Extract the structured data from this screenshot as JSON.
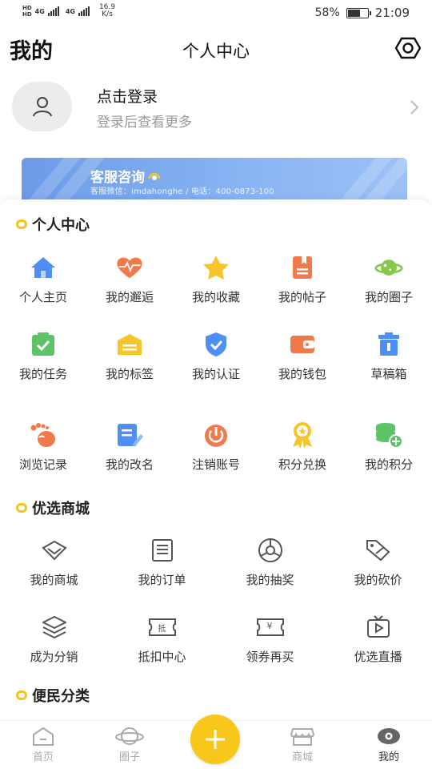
{
  "status_bar": {
    "hd1": "HD",
    "net1": "4G",
    "hd2": "HD",
    "net2": "4G",
    "speed_value": "16.9",
    "speed_unit": "K/s",
    "battery_percent": "58%",
    "battery_level": 0.58,
    "time": "21:09"
  },
  "header": {
    "left_title": "我的",
    "center_title": "个人中心",
    "right_icon": "eye-hexagon-icon"
  },
  "profile": {
    "login_label": "点击登录",
    "login_sub": "登录后查看更多"
  },
  "banner": {
    "title": "客服咨询",
    "subtitle": "客服微信：imdahonghe / 电话：400-0873-100"
  },
  "section_personal": {
    "title": "个人中心",
    "items": [
      {
        "label": "个人主页",
        "icon": "home-icon",
        "color": "#4e8ff5"
      },
      {
        "label": "我的邂逅",
        "icon": "heart-pulse-icon",
        "color": "#f2794a"
      },
      {
        "label": "我的收藏",
        "icon": "star-icon",
        "color": "#f7c42c"
      },
      {
        "label": "我的帖子",
        "icon": "bookmark-doc-icon",
        "color": "#f2794a"
      },
      {
        "label": "我的圈子",
        "icon": "planet-icon",
        "color": "#86c94a"
      },
      {
        "label": "我的任务",
        "icon": "task-check-icon",
        "color": "#5cc366"
      },
      {
        "label": "我的标签",
        "icon": "tag-card-icon",
        "color": "#f7c42c"
      },
      {
        "label": "我的认证",
        "icon": "shield-check-icon",
        "color": "#4e8ff5"
      },
      {
        "label": "我的钱包",
        "icon": "wallet-icon",
        "color": "#f2794a"
      },
      {
        "label": "草稿箱",
        "icon": "trash-box-icon",
        "color": "#4e8ff5"
      },
      {
        "label": "浏览记录",
        "icon": "footprint-icon",
        "color": "#f2794a"
      },
      {
        "label": "我的改名",
        "icon": "edit-doc-icon",
        "color": "#4e8ff5"
      },
      {
        "label": "注销账号",
        "icon": "power-icon",
        "color": "#f2794a"
      },
      {
        "label": "积分兑换",
        "icon": "medal-icon",
        "color": "#f7c42c"
      },
      {
        "label": "我的积分",
        "icon": "coins-plus-icon",
        "color": "#5cc366"
      }
    ]
  },
  "section_mall": {
    "title": "优选商城",
    "items": [
      {
        "label": "我的商城",
        "icon": "diamond-outline-icon"
      },
      {
        "label": "我的订单",
        "icon": "order-list-icon"
      },
      {
        "label": "我的抽奖",
        "icon": "compass-wheel-icon"
      },
      {
        "label": "我的砍价",
        "icon": "price-tag-cut-icon"
      },
      {
        "label": "成为分销",
        "icon": "layers-icon"
      },
      {
        "label": "抵扣中心",
        "icon": "deduct-ticket-icon",
        "badge": "抵"
      },
      {
        "label": "领券再买",
        "icon": "coupon-yen-icon",
        "badge": "¥"
      },
      {
        "label": "优选直播",
        "icon": "tv-play-icon"
      }
    ]
  },
  "section_service": {
    "title": "便民分类"
  },
  "tabbar": {
    "items": [
      {
        "label": "首页",
        "icon": "house-outline-icon"
      },
      {
        "label": "圈子",
        "icon": "planet-outline-icon"
      },
      {
        "label": "商城",
        "icon": "store-outline-icon"
      },
      {
        "label": "我的",
        "icon": "eye-filled-icon"
      }
    ],
    "center_icon": "plus-icon"
  }
}
